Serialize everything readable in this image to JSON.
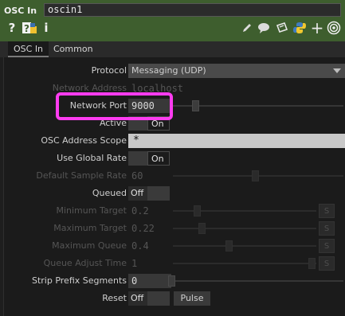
{
  "header": {
    "op_type": "OSC In",
    "op_name": "oscin1",
    "icons_left": [
      "help-icon",
      "python-help-icon",
      "info-icon"
    ],
    "icons_right": [
      "edit-icon",
      "comment-icon",
      "clone-icon",
      "python-icon",
      "add-icon",
      "viewer-icon"
    ],
    "accent": "#3e5e2e"
  },
  "tabs": [
    {
      "label": "OSC In",
      "active": true
    },
    {
      "label": "Common",
      "active": false
    }
  ],
  "params": {
    "protocol": {
      "label": "Protocol",
      "value": "Messaging (UDP)"
    },
    "network_address": {
      "label": "Network Address",
      "value": "localhost"
    },
    "network_port": {
      "label": "Network Port",
      "value": "9000"
    },
    "active": {
      "label": "Active",
      "value": "On"
    },
    "osc_address_scope": {
      "label": "OSC Address Scope",
      "value": "*"
    },
    "use_global_rate": {
      "label": "Use Global Rate",
      "value": "On"
    },
    "default_sample_rate": {
      "label": "Default Sample Rate",
      "value": "60"
    },
    "queued": {
      "label": "Queued",
      "value": "Off"
    },
    "minimum_target": {
      "label": "Minimum Target",
      "value": "0.2",
      "unit": "S"
    },
    "maximum_target": {
      "label": "Maximum Target",
      "value": "0.22",
      "unit": "S"
    },
    "maximum_queue": {
      "label": "Maximum Queue",
      "value": "0.4",
      "unit": "S"
    },
    "queue_adjust_time": {
      "label": "Queue Adjust Time",
      "value": "1",
      "unit": "S"
    },
    "strip_prefix_segments": {
      "label": "Strip Prefix Segments",
      "value": "0"
    },
    "reset": {
      "label": "Reset",
      "value": "Off",
      "pulse_label": "Pulse"
    }
  },
  "highlight_color": "#ff3cf0"
}
